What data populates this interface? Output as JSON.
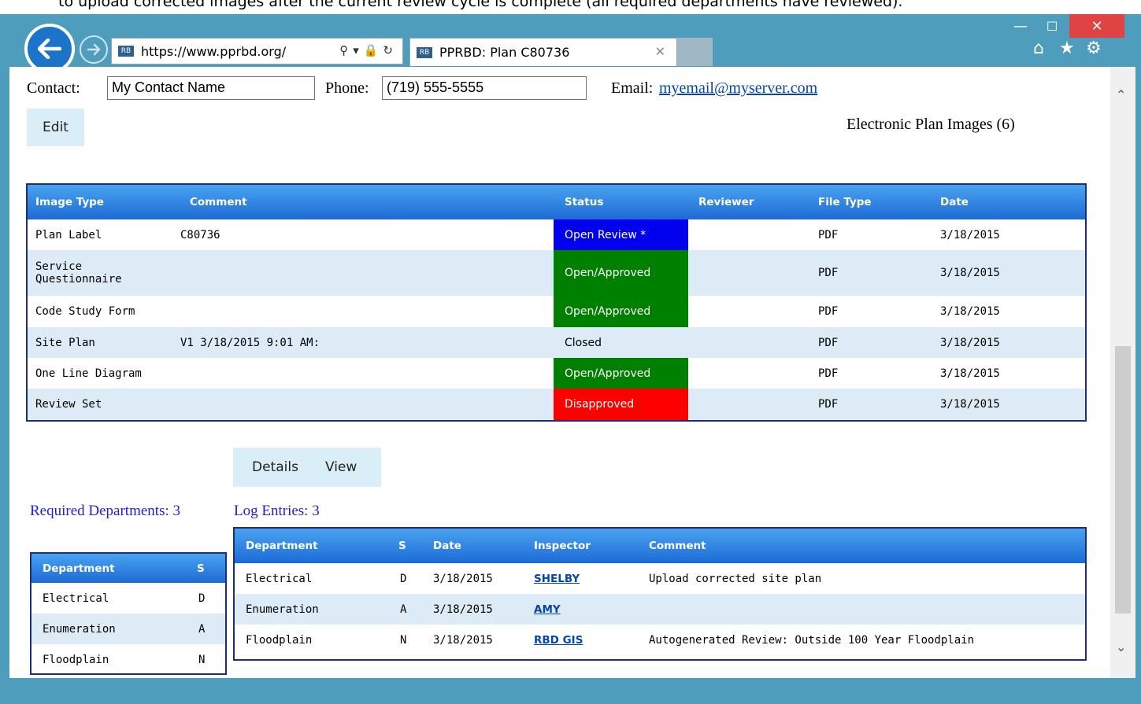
{
  "caption": "to upload corrected images after the current review cycle is complete (all required departments have reviewed).",
  "browser": {
    "url_host": "https://www.pprbd.org/",
    "tab_title": "PPRBD: Plan C80736"
  },
  "contact": {
    "contact_label": "Contact:",
    "contact_value": "My Contact Name",
    "phone_label": "Phone:",
    "phone_value": "(719) 555-5555",
    "email_label": "Email:",
    "email_value": "myemail@myserver.com",
    "edit_label": "Edit"
  },
  "images": {
    "title": "Electronic Plan Images (6)",
    "columns": [
      "Image Type",
      "Comment",
      "Status",
      "Reviewer",
      "File Type",
      "Date"
    ],
    "rows": [
      {
        "image_type": "Plan Label",
        "comment": "C80736",
        "status": "Open Review *",
        "reviewer": "",
        "file_type": "PDF",
        "date": "3/18/2015"
      },
      {
        "image_type_line1": "Service",
        "image_type_line2": "Questionnaire",
        "comment": "",
        "status": "Open/Approved",
        "reviewer": "",
        "file_type": "PDF",
        "date": "3/18/2015"
      },
      {
        "image_type": "Code Study Form",
        "comment": "",
        "status": "Open/Approved",
        "reviewer": "",
        "file_type": "PDF",
        "date": "3/18/2015"
      },
      {
        "image_type": "Site Plan",
        "comment": "V1 3/18/2015 9:01 AM:",
        "status": "Closed",
        "reviewer": "",
        "file_type": "PDF",
        "date": "3/18/2015"
      },
      {
        "image_type": "One Line Diagram",
        "comment": "",
        "status": "Open/Approved",
        "reviewer": "",
        "file_type": "PDF",
        "date": "3/18/2015"
      },
      {
        "image_type": "Review Set",
        "comment": "",
        "status": "Disapproved",
        "reviewer": "",
        "file_type": "PDF",
        "date": "3/18/2015"
      }
    ],
    "status_colors": {
      "open_review": "#0000ee",
      "approved": "#008000",
      "disapproved": "#ff0000"
    }
  },
  "tabs": {
    "details": "Details",
    "view": "View"
  },
  "required_departments": {
    "label": "Required Departments: 3",
    "columns": [
      "Department",
      "S"
    ],
    "rows": [
      {
        "department": "Electrical",
        "s": "D"
      },
      {
        "department": "Enumeration",
        "s": "A"
      },
      {
        "department": "Floodplain",
        "s": "N"
      }
    ]
  },
  "log": {
    "label": "Log Entries: 3",
    "columns": [
      "Department",
      "S",
      "Date",
      "Inspector",
      "Comment"
    ],
    "rows": [
      {
        "department": "Electrical",
        "s": "D",
        "date": "3/18/2015",
        "inspector": "SHELBY",
        "comment": "Upload corrected site plan"
      },
      {
        "department": "Enumeration",
        "s": "A",
        "date": "3/18/2015",
        "inspector": "AMY",
        "comment": ""
      },
      {
        "department": "Floodplain",
        "s": "N",
        "date": "3/18/2015",
        "inspector": "RBD GIS",
        "comment": "Autogenerated Review: Outside 100 Year Floodplain"
      }
    ]
  }
}
